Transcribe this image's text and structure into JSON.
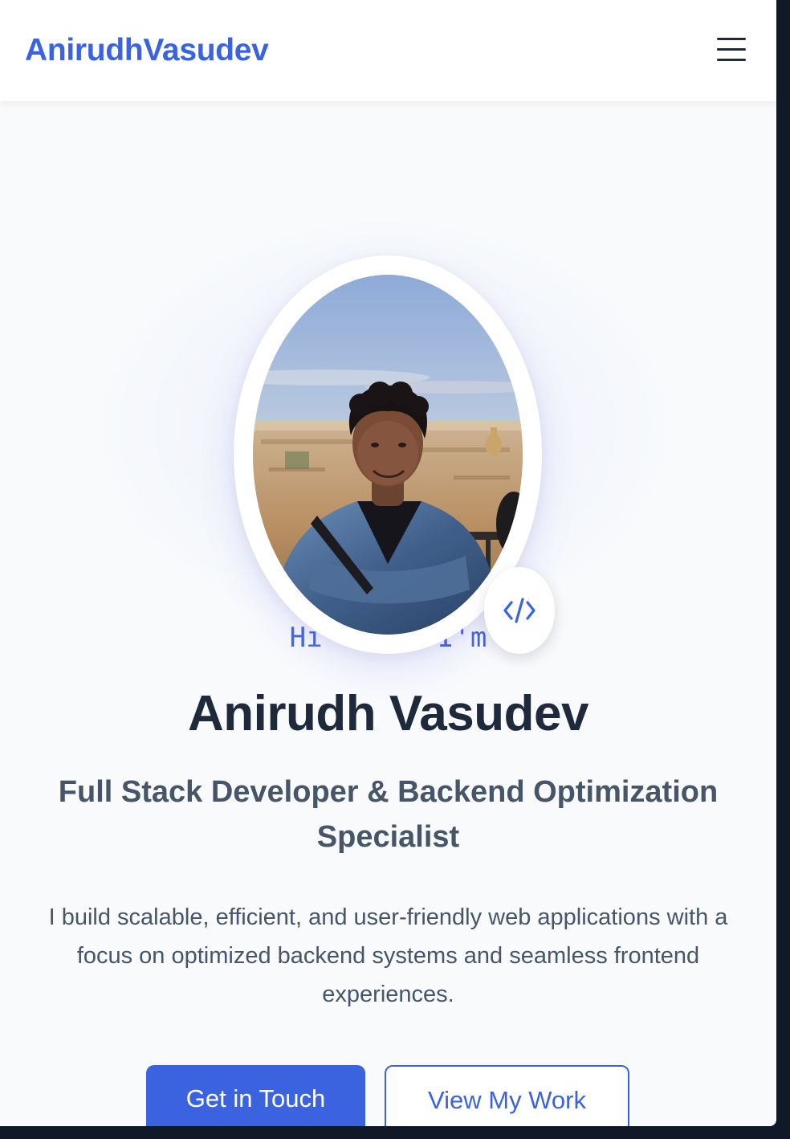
{
  "navbar": {
    "brand": "AnirudhVasudev",
    "menu_icon": "hamburger-menu-icon"
  },
  "hero": {
    "greeting": "Hi   ,   I'm",
    "name": "Anirudh Vasudev",
    "role": "Full Stack Developer & Backend Optimization Specialist",
    "description": "I build scalable, efficient, and user-friendly web applications with a focus on optimized backend systems and seamless frontend experiences.",
    "badge_icon": "code-brackets-icon",
    "primary_button": "Get in Touch",
    "secondary_button": "View My Work"
  },
  "colors": {
    "accent": "#3b63e0",
    "heading": "#1e293b",
    "body_text": "#475569",
    "background": "#f8fafc",
    "nav_background": "#ffffff"
  }
}
